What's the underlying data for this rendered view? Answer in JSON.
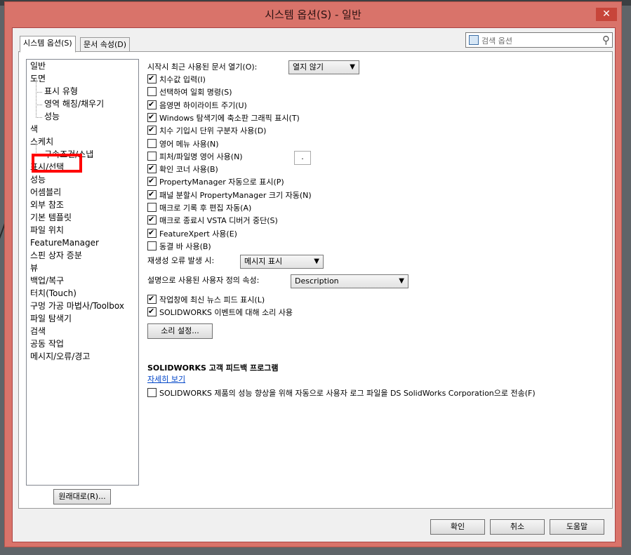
{
  "window": {
    "title": "시스템 옵션(S) - 일반",
    "close_label": "✕"
  },
  "tabs": [
    "시스템 옵션(S)",
    "문서 속성(D)"
  ],
  "search": {
    "placeholder": "검색 옵션"
  },
  "tree": {
    "items": [
      {
        "label": "일반",
        "child": false
      },
      {
        "label": "도면",
        "child": false
      },
      {
        "label": "표시 유형",
        "child": true
      },
      {
        "label": "영역 해칭/채우기",
        "child": true
      },
      {
        "label": "성능",
        "child": true
      },
      {
        "label": "색",
        "child": false
      },
      {
        "label": "스케치",
        "child": false
      },
      {
        "label": "구속조건/스냅",
        "child": true
      },
      {
        "label": "표시/선택",
        "child": false
      },
      {
        "label": "성능",
        "child": false
      },
      {
        "label": "어셈블리",
        "child": false
      },
      {
        "label": "외부 참조",
        "child": false
      },
      {
        "label": "기본 템플릿",
        "child": false
      },
      {
        "label": "파일 위치",
        "child": false
      },
      {
        "label": "FeatureManager",
        "child": false
      },
      {
        "label": "스핀 상자 증분",
        "child": false
      },
      {
        "label": "뷰",
        "child": false
      },
      {
        "label": "백업/복구",
        "child": false
      },
      {
        "label": "터치(Touch)",
        "child": false
      },
      {
        "label": "구멍 가공 마법사/Toolbox",
        "child": false
      },
      {
        "label": "파일 탐색기",
        "child": false
      },
      {
        "label": "검색",
        "child": false
      },
      {
        "label": "공동 작업",
        "child": false
      },
      {
        "label": "메시지/오류/경고",
        "child": false
      }
    ],
    "highlight_color": "#ff0000"
  },
  "reset_button": "원래대로(R)...",
  "options": {
    "open_recent_label": "시작시 최근 사용된 문서 열기(O):",
    "open_recent_value": "열지 않기",
    "checkboxes": [
      {
        "label": "치수값 입력(I)",
        "checked": true
      },
      {
        "label": "선택하여 일회 명령(S)",
        "checked": false
      },
      {
        "label": "음영면 하이라이트 주기(U)",
        "checked": true
      },
      {
        "label": "Windows 탐색기에 축소판 그래픽 표시(T)",
        "checked": true
      },
      {
        "label": "치수 기입시 단위 구분자 사용(D)",
        "checked": true
      },
      {
        "label": "영어 메뉴 사용(N)",
        "checked": false
      },
      {
        "label": "피처/파일명 영어 사용(N)",
        "checked": false
      },
      {
        "label": "확인 코너 사용(B)",
        "checked": true
      },
      {
        "label": "PropertyManager 자동으로 표시(P)",
        "checked": true
      },
      {
        "label": "패널 분할시 PropertyManager 크기 자동(N)",
        "checked": true
      },
      {
        "label": "매크로 기록 후 편집 자동(A)",
        "checked": false
      },
      {
        "label": "매크로 종료시 VSTA 디버거 중단(S)",
        "checked": true
      },
      {
        "label": "FeatureXpert 사용(E)",
        "checked": true
      },
      {
        "label": "동결 바 사용(B)",
        "checked": false
      }
    ],
    "decimal_sep": ".",
    "rebuild_error_label": "재생성 오류 발생 시:",
    "rebuild_error_value": "메시지 표시",
    "custom_prop_label": "설명으로 사용된 사용자 정의 속성:",
    "custom_prop_value": "Description",
    "checkboxes2": [
      {
        "label": "작업창에 최신 뉴스 피드 표시(L)",
        "checked": true
      },
      {
        "label": "SOLIDWORKS 이벤트에 대해 소리 사용",
        "checked": true
      }
    ],
    "sound_button": "소리 설정...",
    "feedback_title": "SOLIDWORKS 고객 피드백 프로그램",
    "feedback_link": "자세히 보기",
    "feedback_checkbox": "SOLIDWORKS 제품의 성능 향상을 위해 자동으로 사용자 로그 파일을 DS SolidWorks Corporation으로 전송(F)",
    "feedback_checked": false
  },
  "footer": {
    "ok": "확인",
    "cancel": "취소",
    "help": "도움말"
  }
}
